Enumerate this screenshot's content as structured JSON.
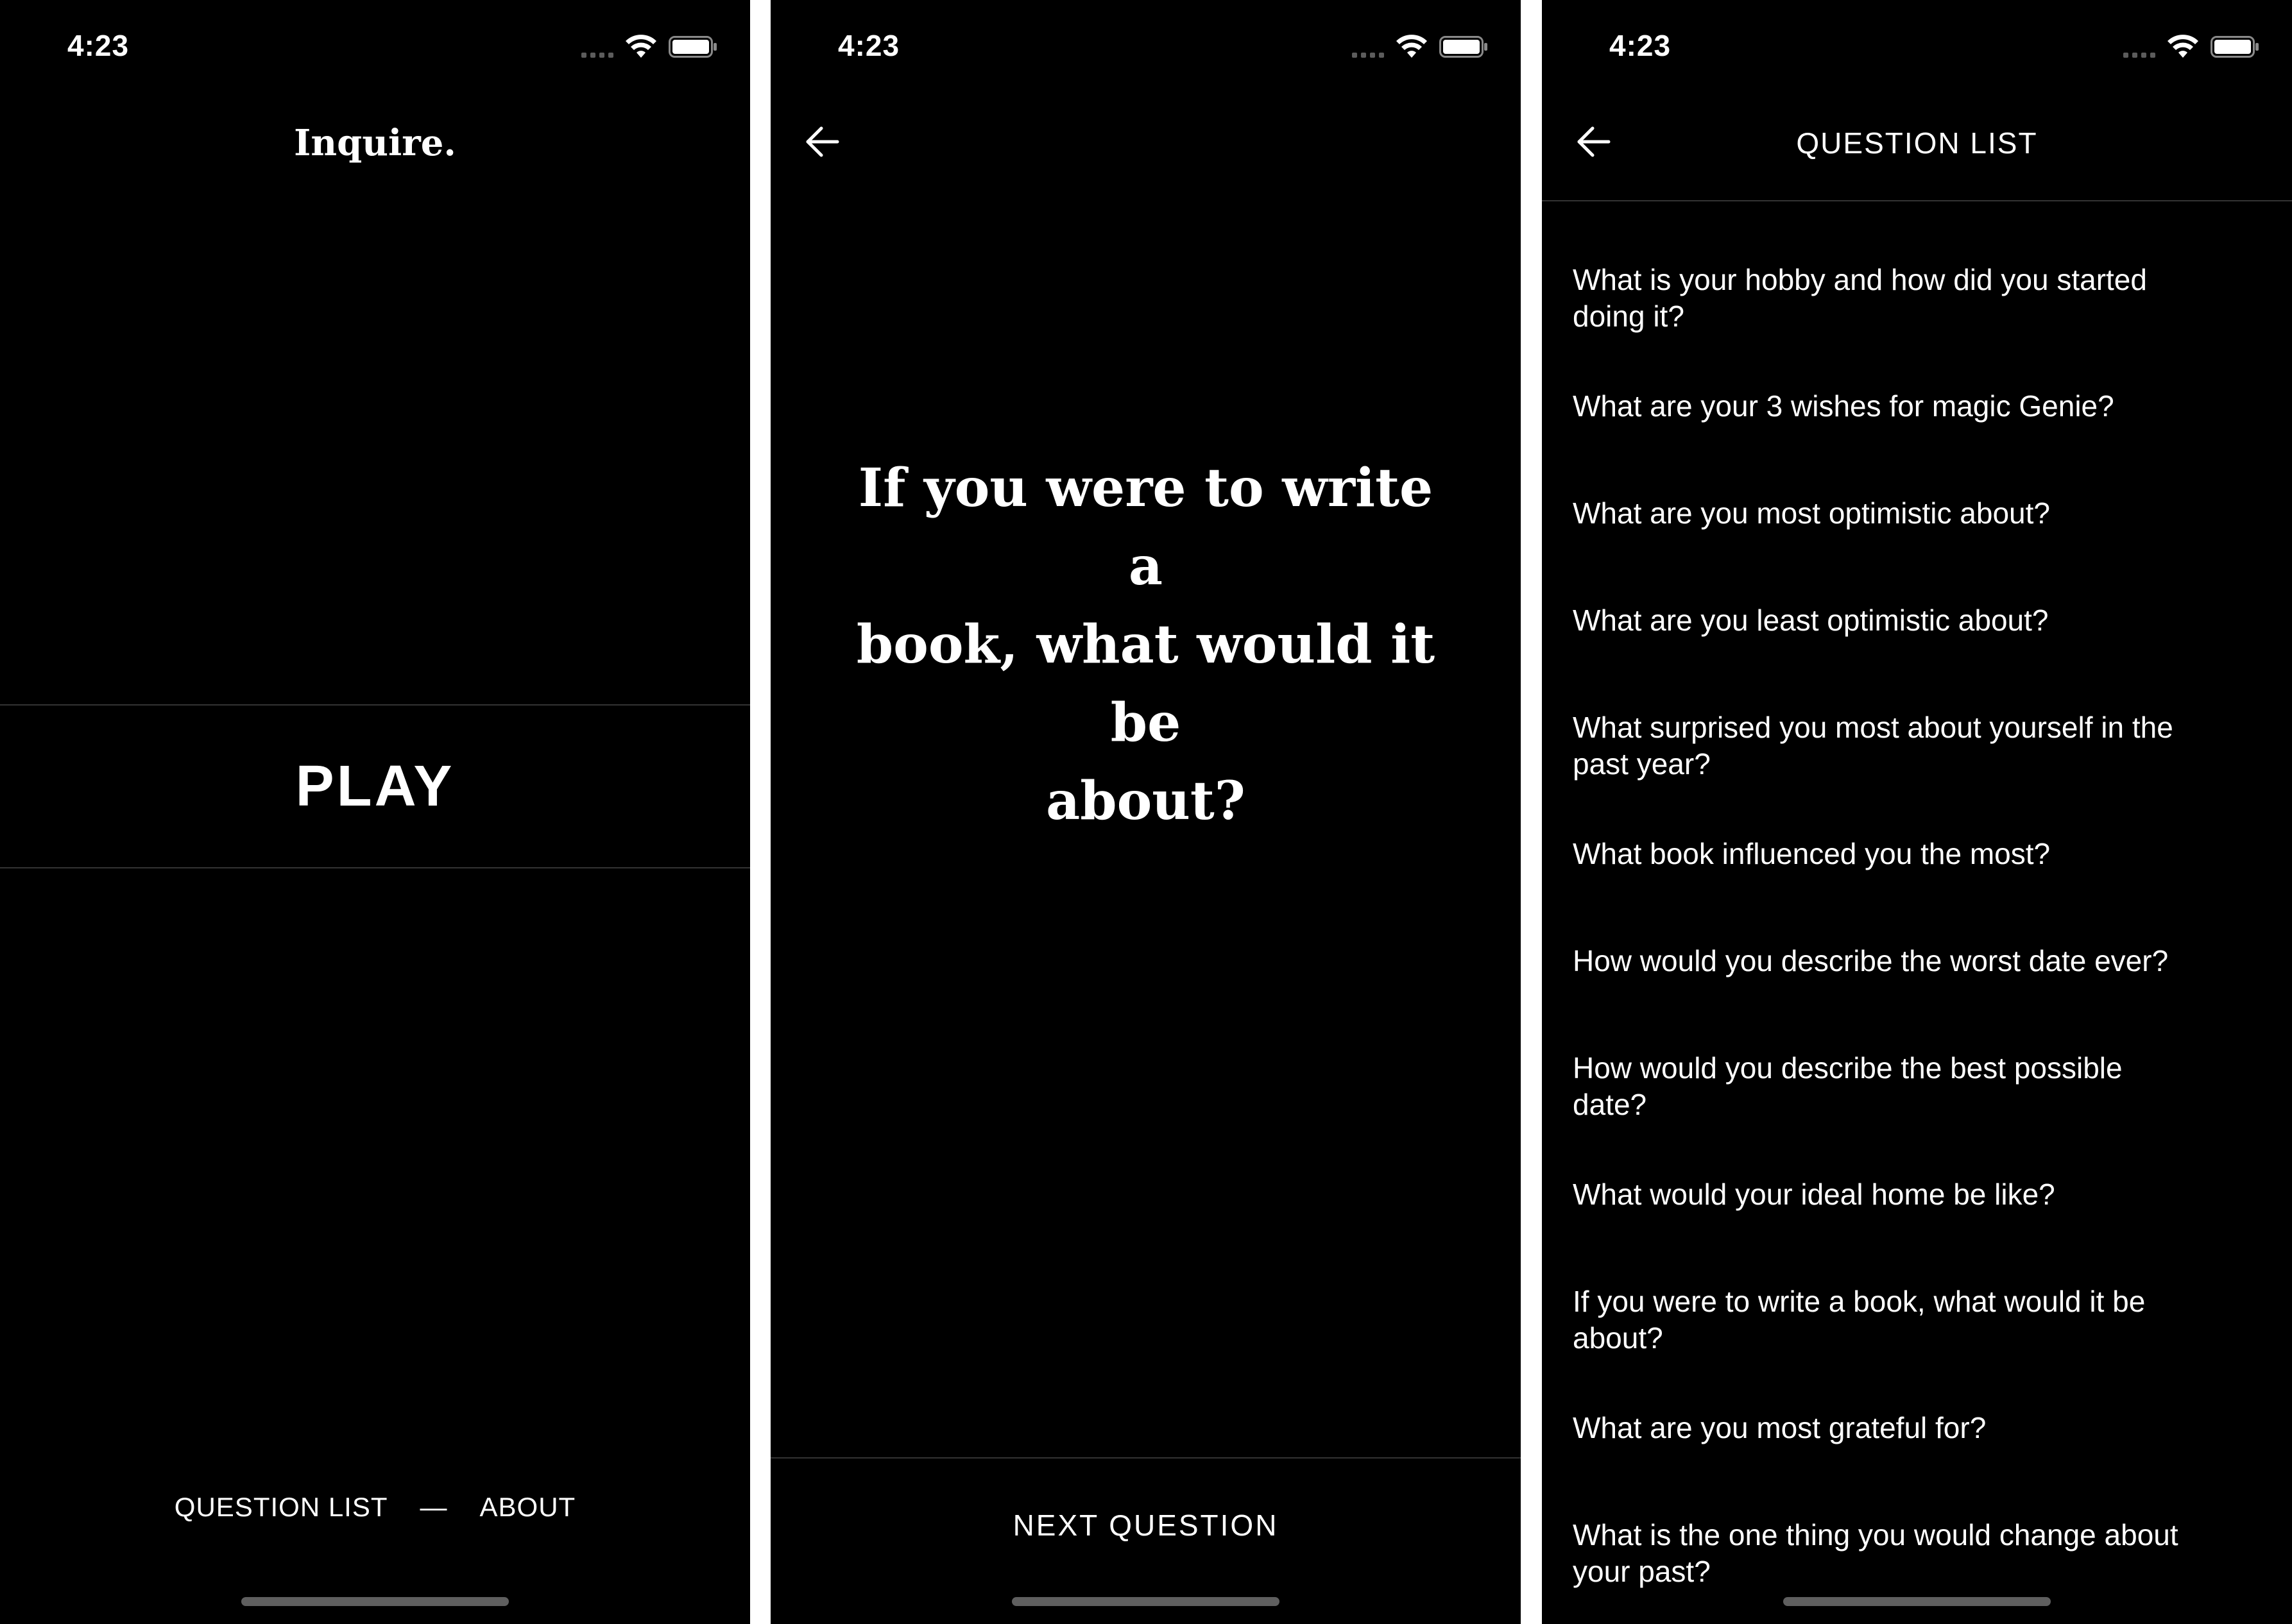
{
  "status_bar": {
    "time": "4:23"
  },
  "home_screen": {
    "logo": "Inquire.",
    "play_label": "PLAY",
    "nav": {
      "question_list_label": "QUESTION LIST",
      "separator": "—",
      "about_label": "ABOUT"
    }
  },
  "question_screen": {
    "question_line_1": "If you were to write a",
    "question_line_2": "book, what would it be",
    "question_line_3": "about?",
    "next_label": "NEXT QUESTION"
  },
  "list_screen": {
    "title": "QUESTION LIST",
    "questions": [
      {
        "line1": "What is your hobby and how did you started",
        "line2": "doing it?"
      },
      {
        "line1": "What are your 3 wishes for magic Genie?",
        "line2": ""
      },
      {
        "line1": "What are you most optimistic about?",
        "line2": ""
      },
      {
        "line1": "What are you least optimistic about?",
        "line2": ""
      },
      {
        "line1": "What surprised you most about yourself in the",
        "line2": "past year?"
      },
      {
        "line1": "What book influenced you the most?",
        "line2": ""
      },
      {
        "line1": "How would you describe the worst date ever?",
        "line2": ""
      },
      {
        "line1": "How would you describe the best possible",
        "line2": "date?"
      },
      {
        "line1": "What would your ideal home be like?",
        "line2": ""
      },
      {
        "line1": "If you were to write a book, what would it be",
        "line2": "about?"
      },
      {
        "line1": "What are you most grateful for?",
        "line2": ""
      },
      {
        "line1": "What is the one thing you would change about",
        "line2": "your past?"
      }
    ]
  },
  "colors": {
    "background": "#000000",
    "text": "#ffffff",
    "divider": "#333333",
    "home_indicator": "#5f5f5f",
    "gutter": "#ffffff"
  },
  "icons": {
    "back": "arrow-left-icon",
    "wifi": "wifi-icon",
    "battery": "battery-icon",
    "signal": "signal-icon"
  }
}
